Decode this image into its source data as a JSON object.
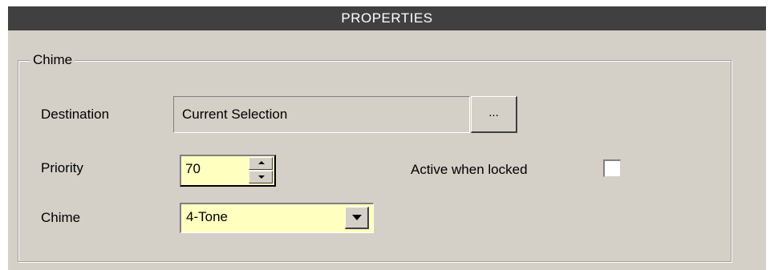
{
  "title_bar": {
    "title": "PROPERTIES"
  },
  "group": {
    "label": "Chime"
  },
  "destination": {
    "label": "Destination",
    "value": "Current Selection",
    "browse_label": "..."
  },
  "priority": {
    "label": "Priority",
    "value": "70"
  },
  "active_when_locked": {
    "label": "Active when locked",
    "checked": false
  },
  "chime": {
    "label": "Chime",
    "selected": "4-Tone"
  },
  "colors": {
    "panel_bg": "#d4d0c8",
    "title_bar_bg": "#404040",
    "input_highlight": "#ffffc0"
  }
}
